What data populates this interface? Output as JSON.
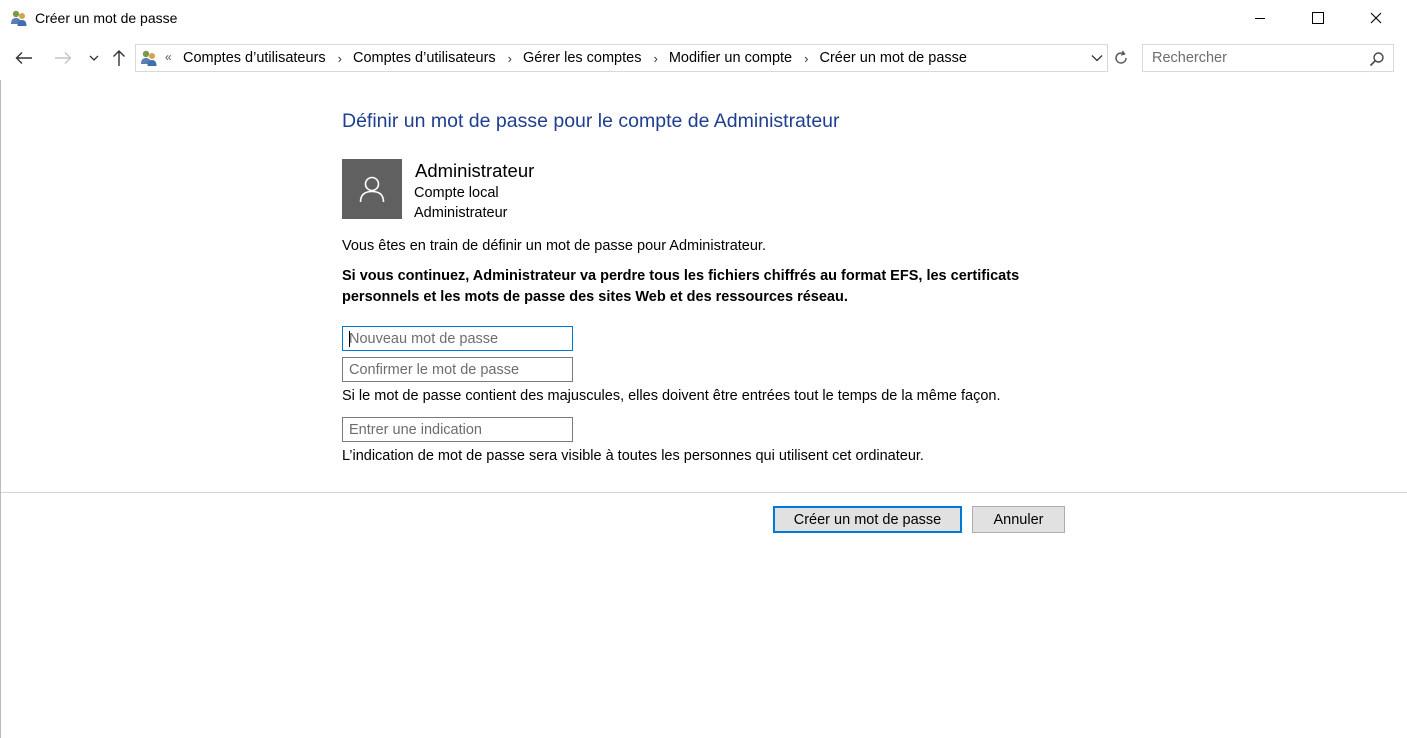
{
  "window": {
    "title": "Créer un mot de passe",
    "app_icon": "user-accounts-icon"
  },
  "navigation": {
    "breadcrumb_prefix": "«",
    "breadcrumbs": [
      "Comptes d’utilisateurs",
      "Comptes d’utilisateurs",
      "Gérer les comptes",
      "Modifier un compte",
      "Créer un mot de passe"
    ],
    "search_placeholder": "Rechercher"
  },
  "main": {
    "heading": "Définir un mot de passe pour le compte de Administrateur",
    "account": {
      "name": "Administrateur",
      "type": "Compte local",
      "role": "Administrateur"
    },
    "info": "Vous êtes en train de définir un mot de passe pour Administrateur.",
    "warning": "Si vous continuez, Administrateur va perdre tous les fichiers chiffrés au format EFS, les certificats personnels et les mots de passe des sites Web et des ressources réseau.",
    "fields": {
      "new_password_placeholder": "Nouveau mot de passe",
      "confirm_password_placeholder": "Confirmer le mot de passe",
      "hint_placeholder": "Entrer une indication"
    },
    "case_note": "Si le mot de passe contient des majuscules, elles doivent être entrées tout le temps de la même façon.",
    "hint_note": "L’indication de mot de passe sera visible à toutes les personnes qui utilisent cet ordinateur."
  },
  "buttons": {
    "create": "Créer un mot de passe",
    "cancel": "Annuler"
  },
  "colors": {
    "heading": "#1e3f8f",
    "focus_accent": "#0078d7",
    "avatar_bg": "#606060"
  }
}
